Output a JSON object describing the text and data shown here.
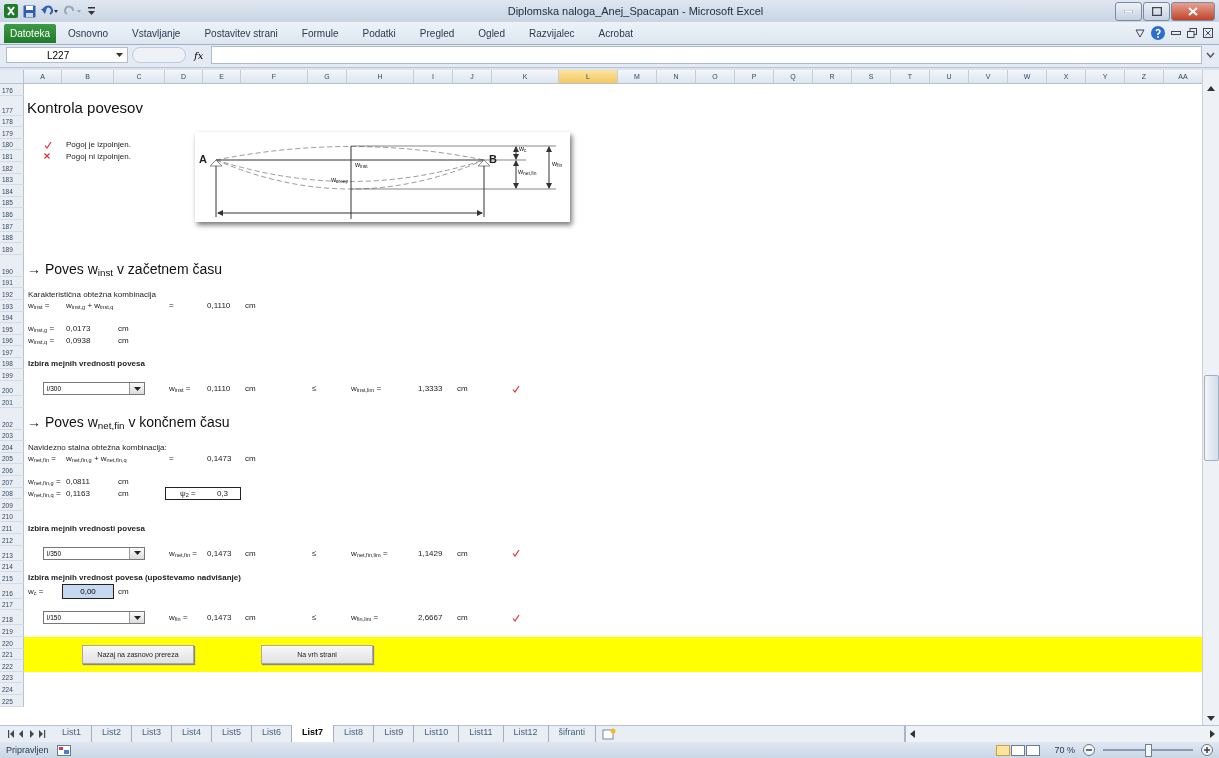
{
  "window": {
    "title": "Diplomska naloga_Anej_Spacapan - Microsoft Excel"
  },
  "ribbon": {
    "file_tab": "Datoteka",
    "tabs": [
      "Osnovno",
      "Vstavljanje",
      "Postavitev strani",
      "Formule",
      "Podatki",
      "Pregled",
      "Ogled",
      "Razvijalec",
      "Acrobat"
    ]
  },
  "formula_bar": {
    "name_box": "L227",
    "function_button": "fx"
  },
  "columns": [
    {
      "label": "A",
      "selected": false
    },
    {
      "label": "B",
      "selected": false
    },
    {
      "label": "C",
      "selected": false
    },
    {
      "label": "D",
      "selected": false
    },
    {
      "label": "E",
      "selected": false
    },
    {
      "label": "F",
      "selected": false
    },
    {
      "label": "G",
      "selected": false
    },
    {
      "label": "H",
      "selected": false
    },
    {
      "label": "I",
      "selected": false
    },
    {
      "label": "J",
      "selected": false
    },
    {
      "label": "K",
      "selected": false
    },
    {
      "label": "L",
      "selected": true
    },
    {
      "label": "M",
      "selected": false
    },
    {
      "label": "N",
      "selected": false
    },
    {
      "label": "O",
      "selected": false
    },
    {
      "label": "P",
      "selected": false
    },
    {
      "label": "Q",
      "selected": false
    },
    {
      "label": "R",
      "selected": false
    },
    {
      "label": "S",
      "selected": false
    },
    {
      "label": "T",
      "selected": false
    },
    {
      "label": "U",
      "selected": false
    },
    {
      "label": "V",
      "selected": false
    },
    {
      "label": "W",
      "selected": false
    },
    {
      "label": "X",
      "selected": false
    },
    {
      "label": "Y",
      "selected": false
    },
    {
      "label": "Z",
      "selected": false
    },
    {
      "label": "AA",
      "selected": false
    }
  ],
  "rows": [
    {
      "number": "176",
      "kind": "normal"
    },
    {
      "number": "177",
      "kind": "title",
      "cells": {
        "A": {
          "kind": "title",
          "text": "Kontrola povesov"
        }
      }
    },
    {
      "number": "178",
      "kind": "normal"
    },
    {
      "number": "179",
      "kind": "normal",
      "cells": {
        "D": {
          "kind": "diagram",
          "labels": [
            {
              "kind": "left",
              "text": "A"
            },
            {
              "kind": "right",
              "text": "B"
            },
            {
              "kind": "inst",
              "text": "w$_{inst}$"
            },
            {
              "kind": "creep",
              "text": "w$_{creep}$"
            },
            {
              "kind": "camber",
              "text": "w$_{c}$"
            },
            {
              "kind": "netfin",
              "text": "w$_{net,fin}$"
            },
            {
              "kind": "fin",
              "text": "w$_{fin}$"
            }
          ]
        }
      }
    },
    {
      "number": "180",
      "kind": "normal",
      "cells": {
        "A": {
          "kind": "check"
        },
        "B": {
          "kind": "text",
          "text": "Pogoj je izpolnjen."
        }
      }
    },
    {
      "number": "181",
      "kind": "normal",
      "cells": {
        "A": {
          "kind": "cross"
        },
        "B": {
          "kind": "text",
          "text": "Pogoj ni izpolnjen."
        }
      }
    },
    {
      "number": "182",
      "kind": "normal"
    },
    {
      "number": "183",
      "kind": "normal"
    },
    {
      "number": "184",
      "kind": "normal"
    },
    {
      "number": "185",
      "kind": "normal"
    },
    {
      "number": "186",
      "kind": "normal"
    },
    {
      "number": "187",
      "kind": "normal"
    },
    {
      "number": "188",
      "kind": "normal"
    },
    {
      "number": "189",
      "kind": "normal"
    },
    {
      "number": "190",
      "kind": "heading",
      "cells": {
        "A": {
          "kind": "heading",
          "text": "→ Poves w$_{inst}$ v začetnem času"
        }
      }
    },
    {
      "number": "191",
      "kind": "normal"
    },
    {
      "number": "192",
      "kind": "normal",
      "cells": {
        "A": {
          "kind": "text",
          "text": "Karakteristična obtežna kombinacija"
        }
      }
    },
    {
      "number": "193",
      "kind": "normal",
      "cells": {
        "A": {
          "kind": "text",
          "text": "w$_{inst}$ ="
        },
        "B": {
          "kind": "text",
          "text": "w$_{inst,g}$ + w$_{inst,q}$"
        },
        "D": {
          "kind": "text",
          "text": "="
        },
        "E": {
          "kind": "text",
          "text": "0,1110"
        },
        "F": {
          "kind": "text",
          "text": "cm"
        }
      }
    },
    {
      "number": "194",
      "kind": "normal"
    },
    {
      "number": "195",
      "kind": "normal",
      "cells": {
        "A": {
          "kind": "text",
          "text": "w$_{inst,g}$ ="
        },
        "B": {
          "kind": "text",
          "text": "0,0173"
        },
        "C": {
          "kind": "text",
          "text": "cm"
        }
      }
    },
    {
      "number": "196",
      "kind": "normal",
      "cells": {
        "A": {
          "kind": "text",
          "text": "w$_{inst,q}$ ="
        },
        "B": {
          "kind": "text",
          "text": "0,0938"
        },
        "C": {
          "kind": "text",
          "text": "cm"
        }
      }
    },
    {
      "number": "197",
      "kind": "normal"
    },
    {
      "number": "198",
      "kind": "normal",
      "cells": {
        "A": {
          "kind": "bold",
          "text": "Izbira mejnih vrednosti povesa"
        }
      }
    },
    {
      "number": "199",
      "kind": "normal"
    },
    {
      "number": "200",
      "kind": "control",
      "cells": {
        "A": {
          "kind": "dropdown",
          "text": "l/300"
        },
        "D": {
          "kind": "text",
          "text": "w$_{inst}$ ="
        },
        "E": {
          "kind": "text",
          "text": "0,1110"
        },
        "F": {
          "kind": "text",
          "text": "cm"
        },
        "G": {
          "kind": "text",
          "text": "≤"
        },
        "H": {
          "kind": "text",
          "text": "w$_{inst,lim}$ ="
        },
        "I": {
          "kind": "text",
          "text": "1,3333"
        },
        "J": {
          "kind": "text",
          "text": "cm"
        },
        "K": {
          "kind": "check"
        }
      }
    },
    {
      "number": "201",
      "kind": "normal"
    },
    {
      "number": "202",
      "kind": "heading",
      "cells": {
        "A": {
          "kind": "heading",
          "text": "→ Poves w$_{net,fin}$ v končnem času"
        }
      }
    },
    {
      "number": "203",
      "kind": "normal"
    },
    {
      "number": "204",
      "kind": "normal",
      "cells": {
        "A": {
          "kind": "text",
          "text": "Navidezno stalna obtežna kombinacija:"
        }
      }
    },
    {
      "number": "205",
      "kind": "normal",
      "cells": {
        "A": {
          "kind": "text",
          "text": "w$_{net,fin}$ ="
        },
        "B": {
          "kind": "text",
          "text": "w$_{net,fin,g}$ + w$_{net,fin,q}$"
        },
        "D": {
          "kind": "text",
          "text": "="
        },
        "E": {
          "kind": "text",
          "text": "0,1473"
        },
        "F": {
          "kind": "text",
          "text": "cm"
        }
      }
    },
    {
      "number": "206",
      "kind": "normal"
    },
    {
      "number": "207",
      "kind": "normal",
      "cells": {
        "A": {
          "kind": "text",
          "text": "w$_{net,fin,g}$ ="
        },
        "B": {
          "kind": "text",
          "text": "0,0811"
        },
        "C": {
          "kind": "text",
          "text": "cm"
        }
      }
    },
    {
      "number": "208",
      "kind": "normal",
      "cells": {
        "A": {
          "kind": "text",
          "text": "w$_{net,fin,q}$ ="
        },
        "B": {
          "kind": "text",
          "text": "0,1163"
        },
        "C": {
          "kind": "text",
          "text": "cm"
        },
        "D": {
          "kind": "boxed",
          "label": "ψ$_{2}$ =",
          "value": "0,3"
        }
      }
    },
    {
      "number": "209",
      "kind": "normal"
    },
    {
      "number": "210",
      "kind": "normal"
    },
    {
      "number": "211",
      "kind": "normal",
      "cells": {
        "A": {
          "kind": "bold",
          "text": "Izbira mejnih vrednosti povesa"
        }
      }
    },
    {
      "number": "212",
      "kind": "normal"
    },
    {
      "number": "213",
      "kind": "control",
      "cells": {
        "A": {
          "kind": "dropdown",
          "text": "l/350"
        },
        "D": {
          "kind": "text",
          "text": "w$_{net,fin}$ ="
        },
        "E": {
          "kind": "text",
          "text": "0,1473"
        },
        "F": {
          "kind": "text",
          "text": "cm"
        },
        "G": {
          "kind": "text",
          "text": "≤"
        },
        "H": {
          "kind": "text",
          "text": "w$_{net,fin,lim}$ ="
        },
        "I": {
          "kind": "text",
          "text": "1,1429"
        },
        "J": {
          "kind": "text",
          "text": "cm"
        },
        "K": {
          "kind": "check"
        }
      }
    },
    {
      "number": "214",
      "kind": "normal"
    },
    {
      "number": "215",
      "kind": "normal",
      "cells": {
        "A": {
          "kind": "bold",
          "text": "Izbira mejnih vrednost povesa (upoštevamo nadvišanje)"
        }
      }
    },
    {
      "number": "216",
      "kind": "control",
      "cells": {
        "A": {
          "kind": "text",
          "text": "w$_{c}$ ="
        },
        "B": {
          "kind": "input",
          "text": "0,00"
        },
        "C": {
          "kind": "text",
          "text": "cm"
        }
      }
    },
    {
      "number": "217",
      "kind": "normal"
    },
    {
      "number": "218",
      "kind": "control",
      "cells": {
        "A": {
          "kind": "dropdown",
          "text": "l/150"
        },
        "D": {
          "kind": "text",
          "text": "w$_{fin}$ ="
        },
        "E": {
          "kind": "text",
          "text": "0,1473"
        },
        "F": {
          "kind": "text",
          "text": "cm"
        },
        "G": {
          "kind": "text",
          "text": "≤"
        },
        "H": {
          "kind": "text",
          "text": "w$_{fin,lim}$ ="
        },
        "I": {
          "kind": "text",
          "text": "2,6667"
        },
        "J": {
          "kind": "text",
          "text": "cm"
        },
        "K": {
          "kind": "check"
        }
      }
    },
    {
      "number": "219",
      "kind": "normal"
    },
    {
      "number": "220",
      "kind": "band",
      "cells": {
        "B": {
          "kind": "button",
          "text": "Nazaj na zasnovo prereza"
        },
        "F": {
          "kind": "button",
          "text": "Na vrh strani"
        }
      }
    },
    {
      "number": "221",
      "kind": "band"
    },
    {
      "number": "222",
      "kind": "band"
    },
    {
      "number": "223",
      "kind": "normal"
    },
    {
      "number": "224",
      "kind": "normal"
    },
    {
      "number": "225",
      "kind": "normal"
    }
  ],
  "sheet_tabs": [
    {
      "label": "List1",
      "selected": false
    },
    {
      "label": "List2",
      "selected": false
    },
    {
      "label": "List3",
      "selected": false
    },
    {
      "label": "List4",
      "selected": false
    },
    {
      "label": "List5",
      "selected": false
    },
    {
      "label": "List6",
      "selected": false
    },
    {
      "label": "List7",
      "selected": true
    },
    {
      "label": "List8",
      "selected": false
    },
    {
      "label": "List9",
      "selected": false
    },
    {
      "label": "List10",
      "selected": false
    },
    {
      "label": "List11",
      "selected": false
    },
    {
      "label": "List12",
      "selected": false
    },
    {
      "label": "šifranti",
      "selected": false
    }
  ],
  "status_bar": {
    "text": "Pripravljen",
    "zoom": "70 %",
    "zoom_slider": {
      "level": 0.5
    }
  }
}
